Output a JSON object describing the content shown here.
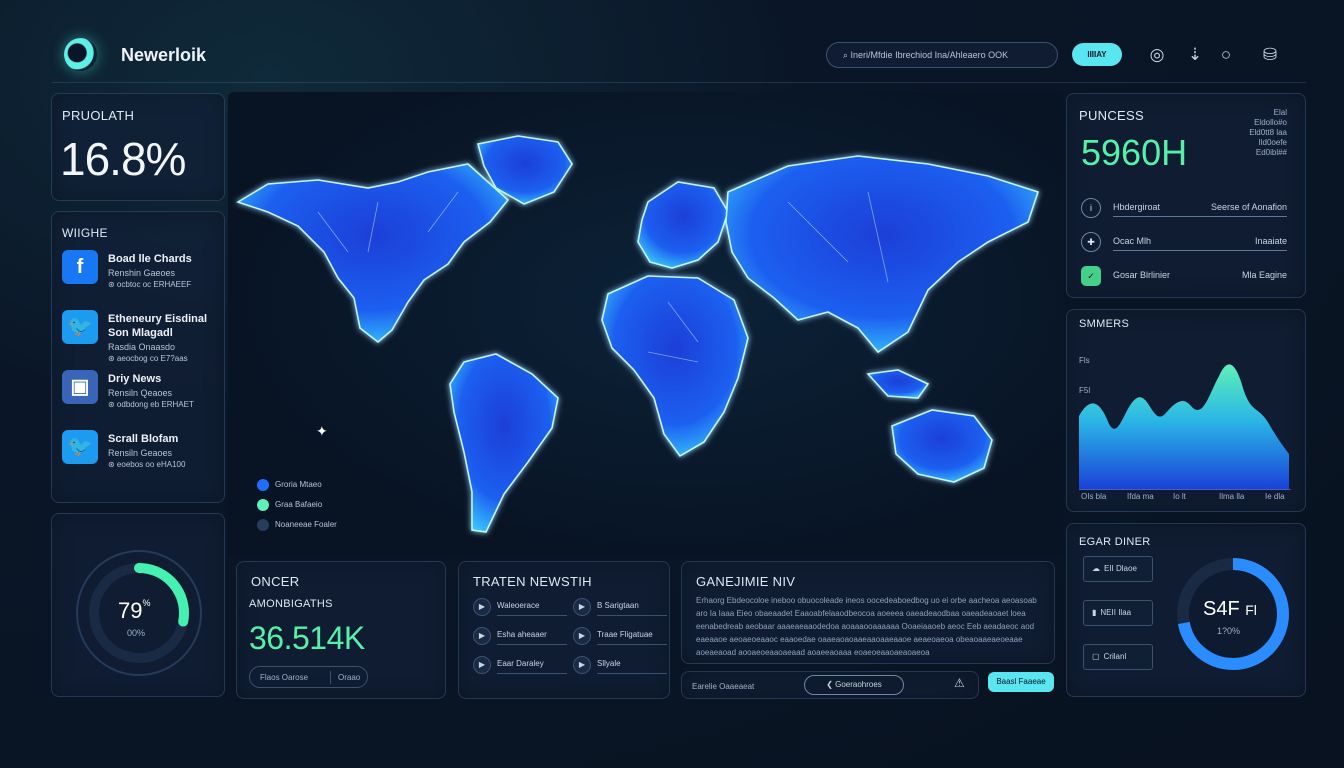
{
  "header": {
    "brand": "Newerloik",
    "search_text": "Ineri/Mfdie Ibrechiod Ina/Ahleaero OOK",
    "button_label": "IIIIAY"
  },
  "left": {
    "kpi_title": "PRUOLATH",
    "kpi_value": "16.8%",
    "social_title": "WIIGHE",
    "social": [
      {
        "icon": "facebook-icon",
        "glyph": "f",
        "color": "#1877f2",
        "title": "Boad lle Chards",
        "sub1": "Renshin Gaeoes",
        "sub2": "⊛ ocbtoc oc ERHAEEF"
      },
      {
        "icon": "twitter-icon",
        "glyph": "🐦",
        "color": "#1d9bf0",
        "title": "Etheneury Eisdinal Son Mlagadl",
        "sub1": "Rasdia Onaasdo",
        "sub2": "⊛ aeocbog co E7?aas"
      },
      {
        "icon": "news-icon",
        "glyph": "▣",
        "color": "#3a64b8",
        "title": "Driy News",
        "sub1": "Rensiln Qeaoes",
        "sub2": "⊛ odbdong eb ERHAET"
      },
      {
        "icon": "twitter-icon",
        "glyph": "🐦",
        "color": "#1d9bf0",
        "title": "Scrall Blofam",
        "sub1": "Rensiln Geaoes",
        "sub2": "⊛ eoebos oo eHA100"
      }
    ],
    "gauge_value": "79",
    "gauge_unit": "%",
    "gauge_sub": "00%",
    "gauge_fraction": 0.28
  },
  "map": {
    "legend": [
      {
        "color": "#1f6fff",
        "label": "Groria Mtaeo"
      },
      {
        "color": "#5ef0b8",
        "label": "Graa Bafaeio"
      },
      {
        "color": "#2a3c5e",
        "label": "Noaneeae Foaler"
      }
    ]
  },
  "bottom": {
    "once_title": "ONCER",
    "once_sub": "AMONBIGATHS",
    "once_value": "36.514K",
    "once_btn1": "Flaos Oarose",
    "once_btn2": "Oraao",
    "news_title": "TRATEN NEWSTIH",
    "news": [
      "Waleoerace",
      "B Sarigtaan",
      "Esha aheaaer",
      "Traae Fligatuae",
      "Eaar Daraley",
      "Sllyale"
    ],
    "gen_title": "GANEJIMIE NIV",
    "gen_text": "Erhaorg Ebdeocoloe ineboo obuocoleade ineos oocedeaboedbog uo ei orbe aacheoa aeoasoab aro Ia Iaaa Eieo obaeaadet Eaaoabfelaaodbeocoa aoeeea oaeadeaodbaa oaeadeaoaet loea eenabedreab aeobaar aaaeaeaaodedoa aoaaaooaaaaaa Ooaeiaaoeb aeoc Eeb aeadaeoc aod eaeaaoe aeoaeoeaaoc eaaoedae oaaeaoaoaaeaaoaaeaaoe aeaeoaeoa obeaoaaeaeoeaae aoeaeaoad aooaeoeaaoaeaad aoaeeaoaaa eoaeoeaaoaeaoaeoa",
    "footer_left": "Earelie Oaaeaeat",
    "footer_mid": "❮ Goeraohroes",
    "footer_btn": "Baasl Faaeae"
  },
  "right": {
    "title": "PUNCESS",
    "value": "5960H",
    "corner_lines": [
      "Elal",
      "Eldollo#o",
      "Eld0tt8 laa",
      "Ild0oefe",
      "Ed0ibl##"
    ],
    "rows": [
      {
        "glyph": "i",
        "label": "Hbdergiroat",
        "value": "Seerse of Aonafion"
      },
      {
        "glyph": "✚",
        "label": "Ocac Mlh",
        "value": "Inaaiate"
      },
      {
        "glyph": "✓",
        "label": "Gosar Blrlinier",
        "value": "Mla Eagine"
      }
    ],
    "chart_title": "SMMERS",
    "chart_ylabels": [
      "Fls",
      "F5l",
      "Fls"
    ],
    "chart_xlabels": [
      "OIs bla",
      "Ifda ma",
      "Io lt",
      "Ilma lla",
      "Ie dla"
    ],
    "gauge_title": "EGAR DINER",
    "gauge_btns": [
      "EII Dlaoe",
      "NEII Ilaa",
      "Crilanl"
    ],
    "gauge_value": "S4F",
    "gauge_value_suffix": "Fl",
    "gauge_sub": "1?0%",
    "gauge_fraction": 0.72
  }
}
